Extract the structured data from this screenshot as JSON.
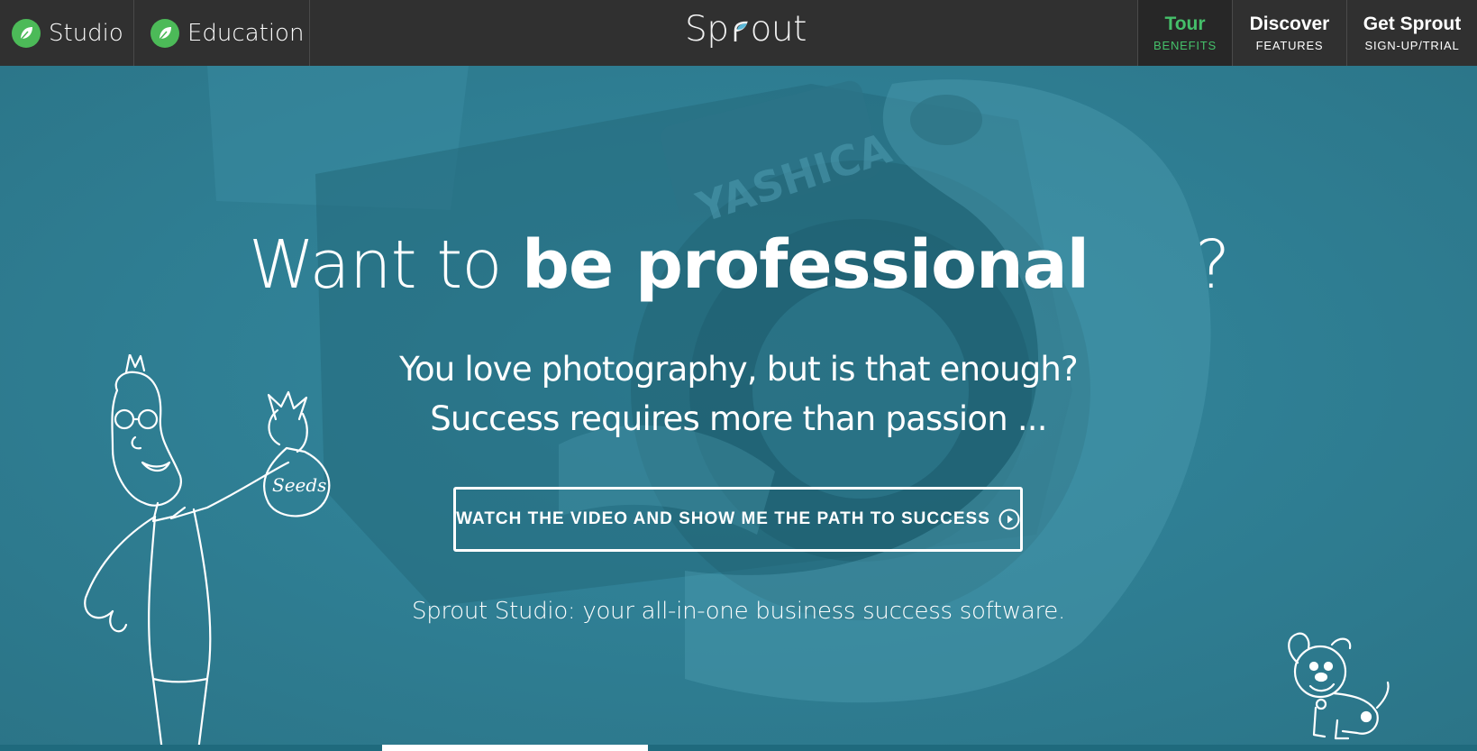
{
  "nav": {
    "tabs": [
      {
        "label": "Studio",
        "icon": "leaf-icon"
      },
      {
        "label": "Education",
        "icon": "leaf-icon"
      }
    ],
    "logo_text_left": "Sp",
    "logo_text_right": "out",
    "right_items": [
      {
        "title": "Tour",
        "subtitle": "BENEFITS",
        "active": true
      },
      {
        "title": "Discover",
        "subtitle": "FEATURES",
        "active": false
      },
      {
        "title": "Get Sprout",
        "subtitle": "SIGN-UP/TRIAL",
        "active": false
      }
    ]
  },
  "hero": {
    "headline_light": "Want to",
    "headline_bold": "be professional",
    "headline_end": "?",
    "subline_1": "You love photography, but is that enough?",
    "subline_2": "Success requires more than passion ...",
    "cta_label": "WATCH THE VIDEO AND SHOW ME THE PATH TO SUCCESS",
    "cta_icon": "play-circle-icon",
    "tagline": "Sprout Studio: your all-in-one business success software.",
    "bag_label": "Seeds"
  },
  "colors": {
    "nav_bg": "#303030",
    "hero_bg": "#2f7f93",
    "accent_green": "#45c06a"
  }
}
